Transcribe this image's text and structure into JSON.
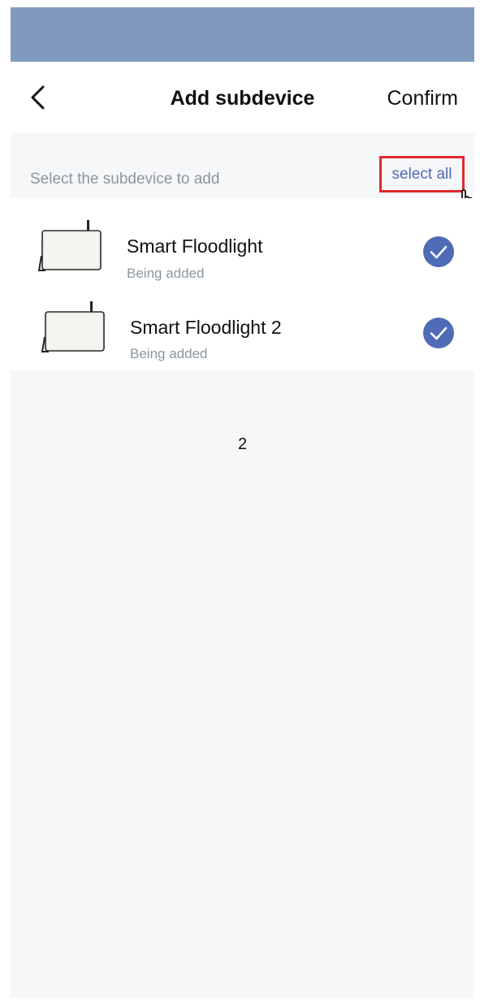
{
  "header": {
    "title": "Add subdevice",
    "confirm_label": "Confirm",
    "back_icon": "chevron-left-icon"
  },
  "section": {
    "hint": "Select the subdevice to add",
    "select_all_label": "select all"
  },
  "devices": [
    {
      "name": "Smart Floodlight",
      "status": "Being added",
      "selected": true,
      "icon": "floodlight-icon"
    },
    {
      "name": "Smart Floodlight 2",
      "status": "Being added",
      "selected": true,
      "icon": "floodlight-icon"
    }
  ],
  "page_number": "2",
  "colors": {
    "status_bar": "#8099bf",
    "accent": "#4f6bb5",
    "highlight_box": "#e0292f",
    "background": "#f6f7f9"
  }
}
